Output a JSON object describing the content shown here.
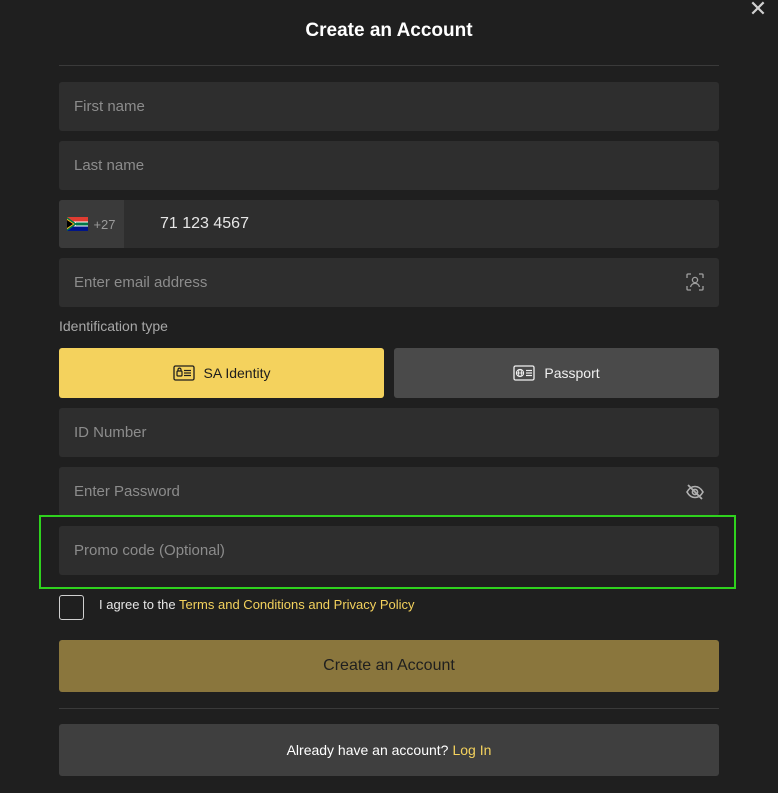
{
  "modal": {
    "title": "Create an Account",
    "close_glyph": "✕"
  },
  "form": {
    "first_name": {
      "placeholder": "First name",
      "value": ""
    },
    "last_name": {
      "placeholder": "Last name",
      "value": ""
    },
    "phone": {
      "country_flag": "south-africa-flag-icon",
      "dial_code": "+27",
      "value": "71 123 4567"
    },
    "email": {
      "placeholder": "Enter email address",
      "value": "",
      "icon": "contact-scan-icon"
    },
    "identification": {
      "label": "Identification type",
      "options": [
        {
          "label": "SA Identity",
          "icon": "id-card-icon",
          "selected": true
        },
        {
          "label": "Passport",
          "icon": "passport-icon",
          "selected": false
        }
      ]
    },
    "id_number": {
      "placeholder": "ID Number",
      "value": ""
    },
    "password": {
      "placeholder": "Enter Password",
      "value": "",
      "icon": "eye-off-icon"
    },
    "promo_code": {
      "placeholder": "Promo code (Optional)",
      "value": ""
    },
    "agreement": {
      "prefix": "I agree to the ",
      "link_text": "Terms and Conditions and Privacy Policy",
      "checked": false
    },
    "submit_label": "Create an Account"
  },
  "footer": {
    "prompt": "Already have an account?",
    "login_link": "Log In"
  },
  "colors": {
    "background": "#1f1f1f",
    "field": "#2e2e2e",
    "accent_yellow": "#f4d25d",
    "submit_disabled": "#8a763d",
    "highlight_green": "#2fd21e"
  }
}
